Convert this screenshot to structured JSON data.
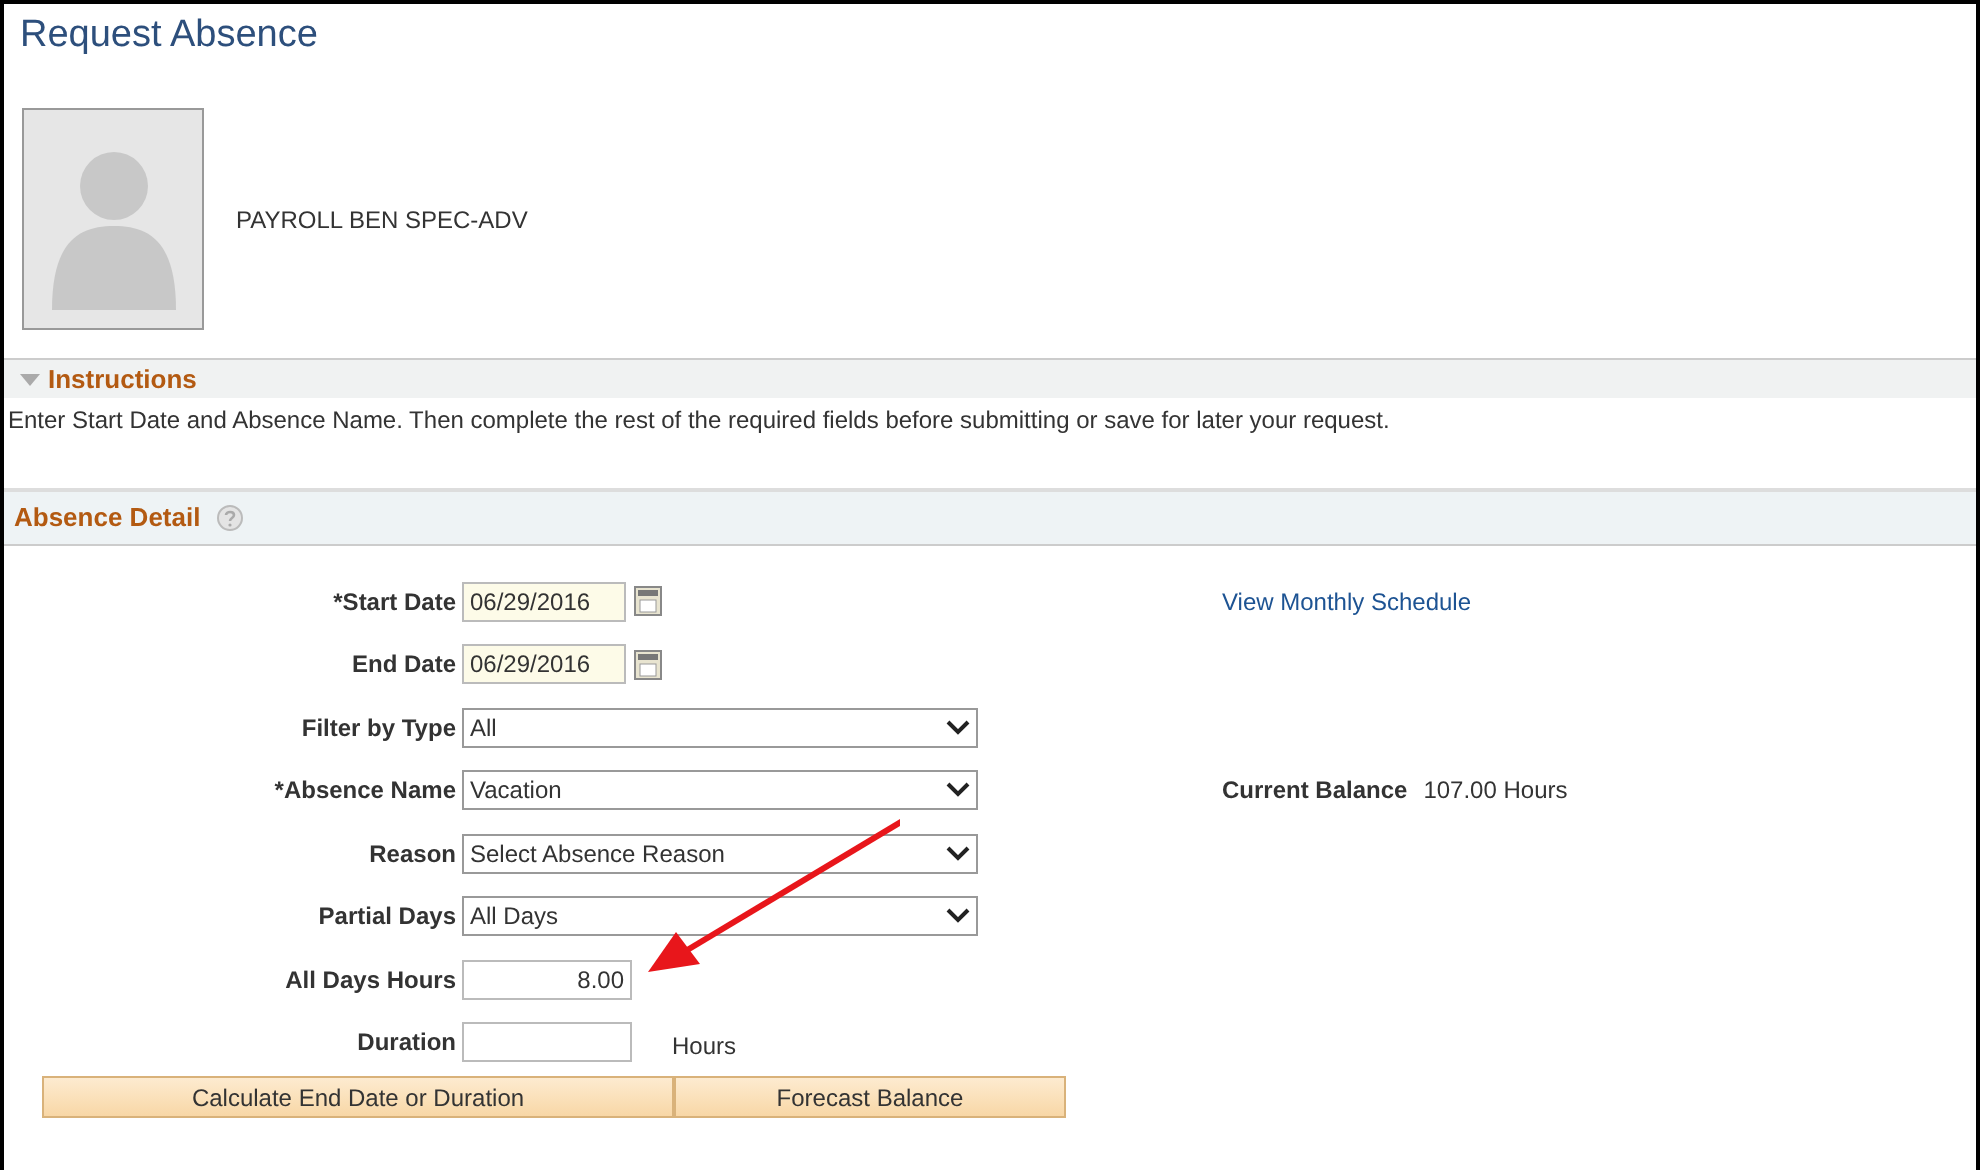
{
  "page": {
    "title": "Request Absence"
  },
  "employee": {
    "name": "PAYROLL BEN SPEC-ADV"
  },
  "instructions": {
    "title": "Instructions",
    "expanded": true,
    "text": "Enter Start Date and Absence Name. Then complete the rest of the required fields before submitting or save for later your request."
  },
  "absence_detail": {
    "title": "Absence Detail",
    "fields": [
      {
        "kind": "date",
        "label": "*Start Date",
        "value": "06/29/2016",
        "side": {
          "kind": "link",
          "text": "View Monthly Schedule"
        }
      },
      {
        "kind": "date",
        "label": "End Date",
        "value": "06/29/2016"
      },
      {
        "kind": "select",
        "label": "Filter by Type",
        "value": "All"
      },
      {
        "kind": "select",
        "label": "*Absence Name",
        "value": "Vacation",
        "side": {
          "kind": "info",
          "label": "Current Balance",
          "text": "107.00 Hours"
        }
      },
      {
        "kind": "select",
        "label": "Reason",
        "value": "Select Absence Reason"
      },
      {
        "kind": "select",
        "label": "Partial Days",
        "value": "All Days"
      },
      {
        "kind": "number",
        "label": "All Days Hours",
        "value": "8.00"
      },
      {
        "kind": "number",
        "label": "Duration",
        "unit": "Hours"
      }
    ],
    "buttons": [
      "Calculate End Date or Duration",
      "Forecast Balance"
    ]
  }
}
